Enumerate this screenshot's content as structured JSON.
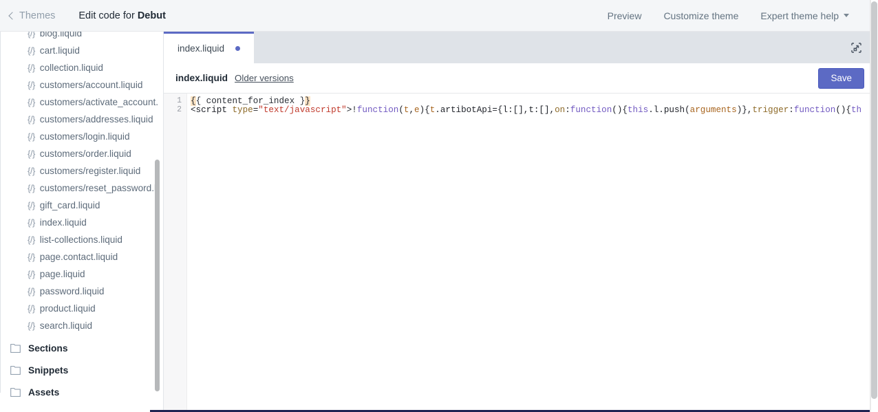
{
  "topbar": {
    "back_label": "Themes",
    "back_icon": "chevron-left-icon",
    "title_prefix": "Edit code for ",
    "title_theme": "Debut",
    "nav": [
      {
        "label": "Preview",
        "icon": null
      },
      {
        "label": "Customize theme",
        "icon": null
      },
      {
        "label": "Expert theme help",
        "icon": "caret-down-icon"
      }
    ]
  },
  "sidebar": {
    "file_icon": "{/}",
    "files": [
      {
        "name": "blog.liquid"
      },
      {
        "name": "cart.liquid"
      },
      {
        "name": "collection.liquid"
      },
      {
        "name": "customers/account.liquid"
      },
      {
        "name": "customers/activate_account."
      },
      {
        "name": "customers/addresses.liquid"
      },
      {
        "name": "customers/login.liquid"
      },
      {
        "name": "customers/order.liquid"
      },
      {
        "name": "customers/register.liquid"
      },
      {
        "name": "customers/reset_password.li"
      },
      {
        "name": "gift_card.liquid"
      },
      {
        "name": "index.liquid"
      },
      {
        "name": "list-collections.liquid"
      },
      {
        "name": "page.contact.liquid"
      },
      {
        "name": "page.liquid"
      },
      {
        "name": "password.liquid"
      },
      {
        "name": "product.liquid"
      },
      {
        "name": "search.liquid"
      }
    ],
    "folders": [
      {
        "name": "Sections",
        "icon": "folder-icon"
      },
      {
        "name": "Snippets",
        "icon": "folder-icon"
      },
      {
        "name": "Assets",
        "icon": "folder-icon"
      }
    ]
  },
  "editor": {
    "tabs": [
      {
        "label": "index.liquid",
        "unsaved": true,
        "active": true
      }
    ],
    "expand_icon": "collapse-arrows-icon",
    "file_name": "index.liquid",
    "older_versions_label": "Older versions",
    "save_label": "Save",
    "line_numbers": [
      "1",
      "2"
    ],
    "code_lines": [
      {
        "number": "1",
        "tokens": [
          {
            "text": "{",
            "type": "brace-hl"
          },
          {
            "text": "{ content_for_index }",
            "type": "liquid"
          },
          {
            "text": "}",
            "type": "brace-hl"
          }
        ]
      },
      {
        "number": "2",
        "tokens": [
          {
            "text": "<script ",
            "type": "tag"
          },
          {
            "text": "type",
            "type": "attr"
          },
          {
            "text": "=",
            "type": "punct"
          },
          {
            "text": "\"text/javascript\"",
            "type": "string"
          },
          {
            "text": ">!",
            "type": "punct"
          },
          {
            "text": "function",
            "type": "kw"
          },
          {
            "text": "(",
            "type": "punct"
          },
          {
            "text": "t",
            "type": "var"
          },
          {
            "text": ",",
            "type": "punct"
          },
          {
            "text": "e",
            "type": "var"
          },
          {
            "text": "){",
            "type": "punct"
          },
          {
            "text": "t",
            "type": "var"
          },
          {
            "text": ".artibotApi={l:[],t:[],",
            "type": "punct"
          },
          {
            "text": "on",
            "type": "prop"
          },
          {
            "text": ":",
            "type": "punct"
          },
          {
            "text": "function",
            "type": "kw"
          },
          {
            "text": "(){",
            "type": "punct"
          },
          {
            "text": "this",
            "type": "this"
          },
          {
            "text": ".l.push(",
            "type": "punct"
          },
          {
            "text": "arguments",
            "type": "var"
          },
          {
            "text": ")},",
            "type": "punct"
          },
          {
            "text": "trigger",
            "type": "prop"
          },
          {
            "text": ":",
            "type": "punct"
          },
          {
            "text": "function",
            "type": "kw"
          },
          {
            "text": "(){",
            "type": "punct"
          },
          {
            "text": "th",
            "type": "this"
          }
        ]
      }
    ]
  },
  "colors": {
    "accent": "#5c6ac4",
    "topbar_bg": "#f4f6f8",
    "tabstrip_bg": "#dfe3e8",
    "bracket_highlight": "#fbe3c4",
    "scrollbar": "#b6b8ba",
    "hscroll": "#1f2452"
  }
}
